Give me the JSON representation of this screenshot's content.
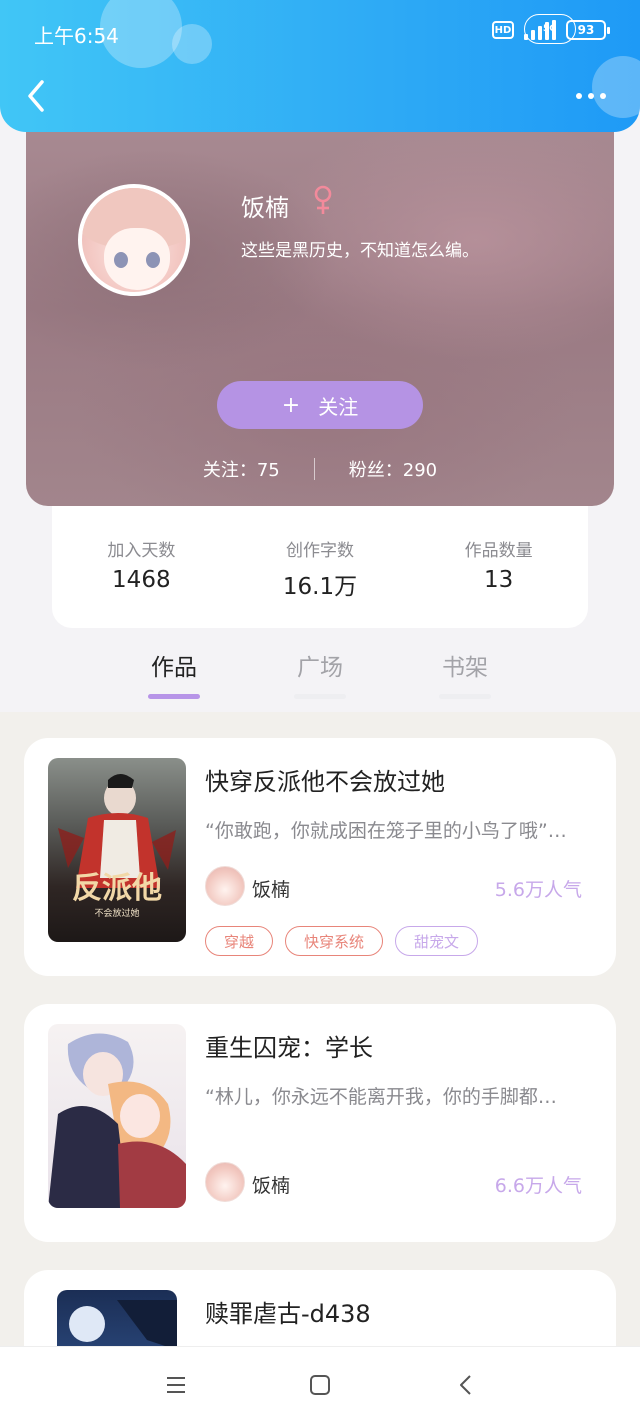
{
  "status_bar": {
    "time": "上午6:54",
    "hd": "HD",
    "network": "5G",
    "battery": "93"
  },
  "header": {
    "back_icon": "chevron-left-icon",
    "more_icon": "more-dots-icon"
  },
  "profile": {
    "name": "饭楠",
    "gender_symbol": "♀",
    "bio": "这些是黑历史，不知道怎么编。",
    "follow_plus": "+",
    "follow_label": "关注",
    "following": "关注：75",
    "followers": "粉丝：290"
  },
  "stats": [
    {
      "label": "加入天数",
      "value": "1468"
    },
    {
      "label": "创作字数",
      "value": "16.1万"
    },
    {
      "label": "作品数量",
      "value": "13"
    }
  ],
  "tabs": [
    {
      "label": "作品",
      "active": true
    },
    {
      "label": "广场",
      "active": false
    },
    {
      "label": "书架",
      "active": false
    }
  ],
  "books": [
    {
      "title": "快穿反派他不会放过她",
      "desc": "“你敢跑，你就成困在笼子里的小鸟了哦”…",
      "author": "饭楠",
      "popularity": "5.6万人气",
      "cover_title": "反派他",
      "cover_subtitle": "不会放过她",
      "tags": [
        {
          "label": "穿越",
          "color": "#e8857a"
        },
        {
          "label": "快穿系统",
          "color": "#e8857a"
        },
        {
          "label": "甜宠文",
          "color": "#c7a8ea"
        }
      ]
    },
    {
      "title": "重生囚宠：学长",
      "desc": "“林儿，你永远不能离开我，你的手脚都…",
      "author": "饭楠",
      "popularity": "6.6万人气"
    },
    {
      "title": "赎罪虐古-d438"
    }
  ],
  "navbar": {
    "menu_icon": "menu-icon",
    "home_icon": "home-square-icon",
    "back_icon": "back-triangle-icon"
  },
  "colors": {
    "accent": "#b593e4",
    "header": "#2eaaf5",
    "popularity": "#c7a8ea"
  }
}
